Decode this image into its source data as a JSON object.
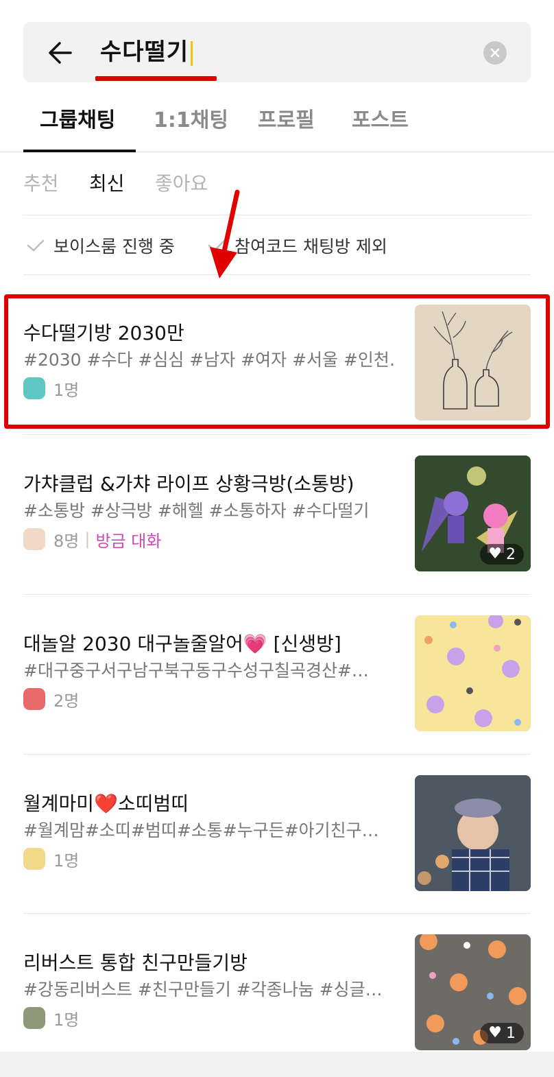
{
  "search": {
    "query": "수다떨기"
  },
  "tabs": [
    {
      "label": "그룹채팅"
    },
    {
      "label": "1:1채팅"
    },
    {
      "label": "프로필"
    },
    {
      "label": "포스트"
    }
  ],
  "sort": [
    {
      "label": "추천"
    },
    {
      "label": "최신"
    },
    {
      "label": "좋아요"
    }
  ],
  "filters": [
    {
      "label": "보이스룸 진행 중"
    },
    {
      "label": "참여코드 채팅방 제외"
    }
  ],
  "rooms": [
    {
      "title": "수다떨기방 2030만",
      "tags": "#2030 #수다 #심심 #남자 #여자 #서울 #인천…",
      "members": "1명",
      "status": "",
      "likes": ""
    },
    {
      "title": "가챠클럽 &가챠 라이프 상황극방(소통방)",
      "tags": "#소통방 #상극방 #해헬 #소통하자 #수다떨기",
      "members": "8명",
      "status": "방금 대화",
      "likes": "2"
    },
    {
      "title_before": "대놀알 2030 대구놀줄알어",
      "title_after": " [신생방]",
      "tags": "#대구중구서구남구북구동구수성구칠곡경산#…",
      "members": "2명",
      "status": "",
      "likes": ""
    },
    {
      "title_before": "월계마미",
      "title_after": "소띠범띠",
      "tags": "#월계맘#소띠#범띠#소통#누구든#아기친구…",
      "members": "1명",
      "status": "",
      "likes": ""
    },
    {
      "title": "리버스트 통합 친구만들기방",
      "tags": "#강동리버스트 #친구만들기 #각종나눔 #싱글…",
      "members": "1명",
      "status": "",
      "likes": "1"
    }
  ],
  "colors": {
    "annotation": "#e00000",
    "accent_caret": "#f5c400",
    "status": "#d14ab6"
  }
}
